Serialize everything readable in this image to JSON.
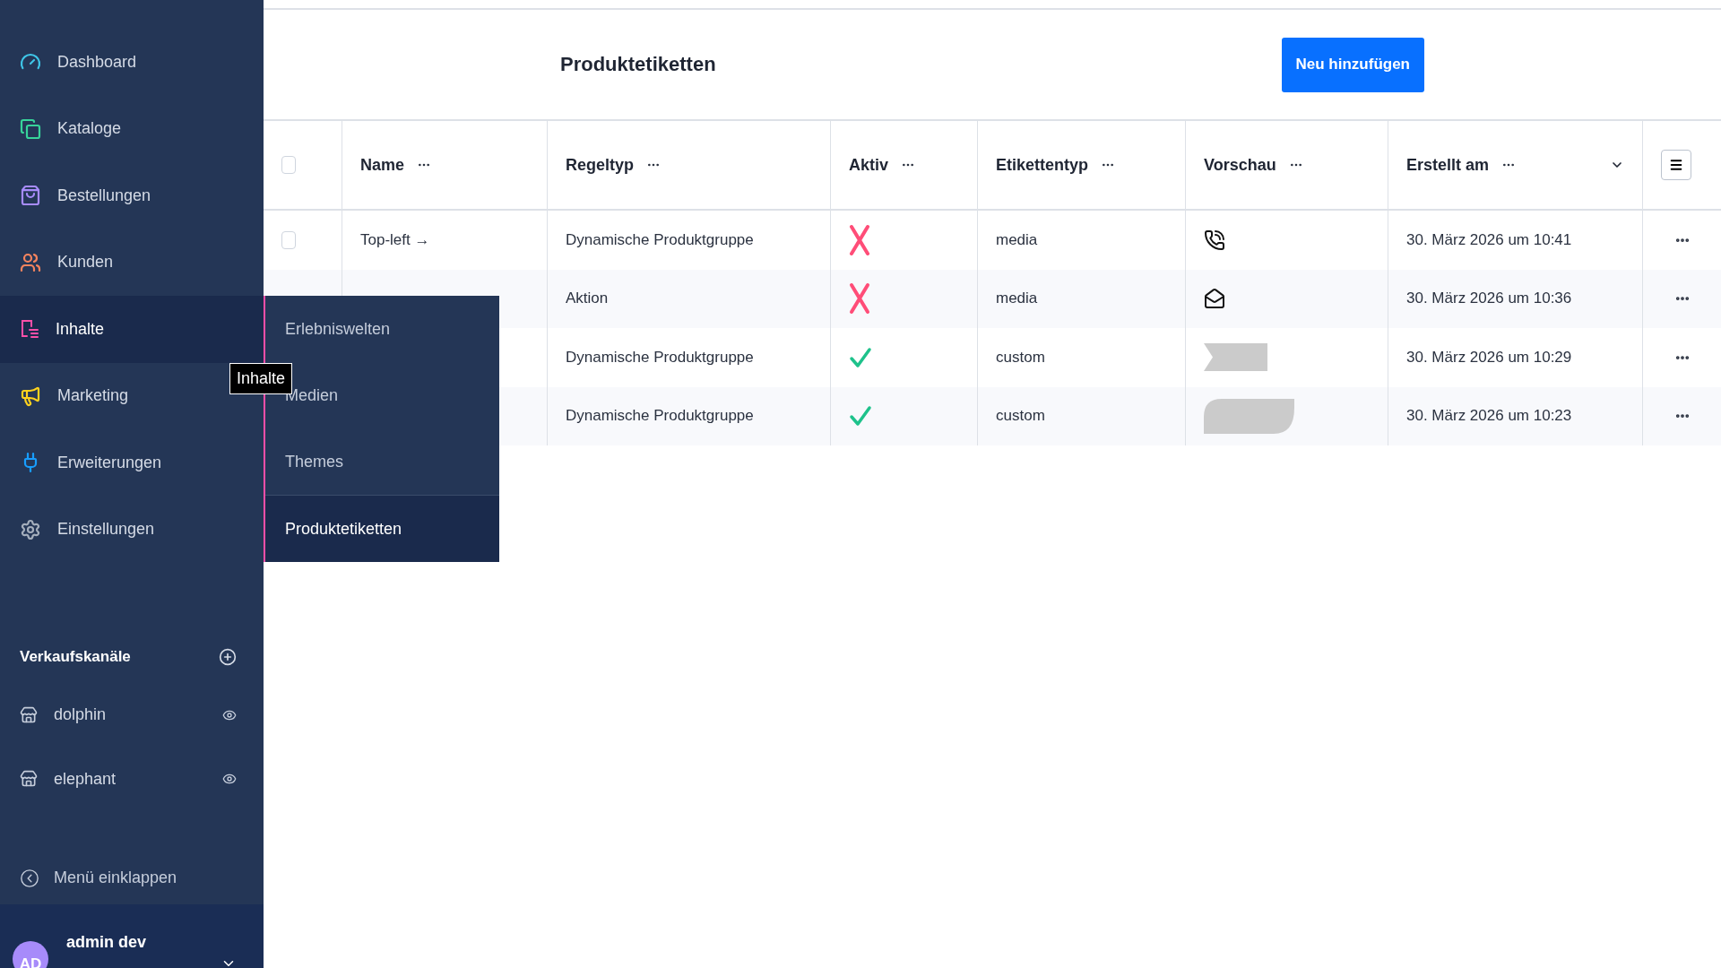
{
  "sidebar": {
    "items": [
      {
        "label": "Dashboard",
        "color": "#3fc6e8",
        "selected": false
      },
      {
        "label": "Kataloge",
        "color": "#37d39a",
        "selected": false
      },
      {
        "label": "Bestellungen",
        "color": "#a78bfa",
        "selected": false
      },
      {
        "label": "Kunden",
        "color": "#f5845e",
        "selected": false
      },
      {
        "label": "Inhalte",
        "color": "#ff4fa8",
        "selected": true
      },
      {
        "label": "Marketing",
        "color": "#ffd21e",
        "selected": false
      },
      {
        "label": "Erweiterungen",
        "color": "#189eff",
        "selected": false
      },
      {
        "label": "Einstellungen",
        "color": "#a4aebc",
        "selected": false
      }
    ],
    "tooltip": "Inhalte",
    "flyout": [
      {
        "label": "Erlebniswelten",
        "selected": false
      },
      {
        "label": "Medien",
        "selected": false
      },
      {
        "label": "Themes",
        "selected": false
      },
      {
        "label": "Produktetiketten",
        "selected": true
      }
    ],
    "sales_channels": {
      "title": "Verkaufskanäle",
      "items": [
        {
          "label": "dolphin"
        },
        {
          "label": "elephant"
        }
      ]
    },
    "collapse": "Menü einklappen",
    "user": {
      "initials": "AD",
      "name": "admin dev"
    }
  },
  "page": {
    "title": "Produktetiketten",
    "add_button": "Neu hinzufügen"
  },
  "table": {
    "select_all_checked": false,
    "columns": [
      {
        "label": "Name",
        "sorted": false
      },
      {
        "label": "Regeltyp",
        "sorted": false
      },
      {
        "label": "Aktiv",
        "sorted": false
      },
      {
        "label": "Etikettentyp",
        "sorted": false
      },
      {
        "label": "Vorschau",
        "sorted": false
      },
      {
        "label": "Erstellt am",
        "sorted": true
      }
    ],
    "rows": [
      {
        "checked": false,
        "name": "Top-left →",
        "rule_type": "Dynamische Produktgruppe",
        "active": false,
        "label_type": "media",
        "kind": "phone",
        "created": "30. März 2026 um 10:41"
      },
      {
        "rule_type": "Aktion",
        "active": false,
        "label_type": "media",
        "kind": "envelope",
        "created": "30. März 2026 um 10:36"
      },
      {
        "rule_type": "Dynamische Produktgruppe",
        "active": true,
        "label_type": "custom",
        "kind": "ribbon",
        "created": "30. März 2026 um 10:29"
      },
      {
        "rule_type": "Dynamische Produktgruppe",
        "active": true,
        "label_type": "custom",
        "kind": "tag",
        "created": "30. März 2026 um 10:23"
      }
    ]
  }
}
